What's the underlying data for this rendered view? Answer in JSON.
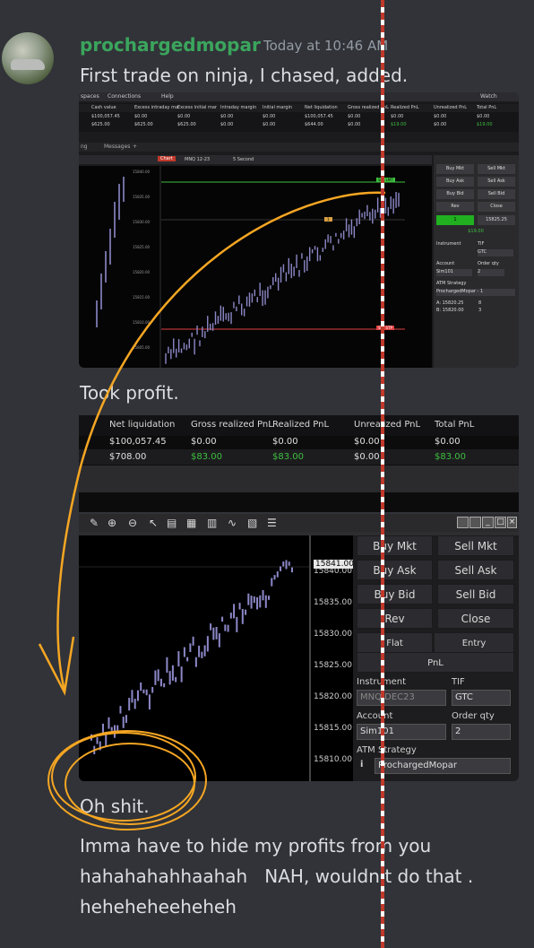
{
  "message": {
    "username": "prochargedmopar",
    "timestamp": "Today at 10:46 AM",
    "line1": "First trade on ninja, I chased, added.",
    "line2": "Took profit.",
    "line3": "Oh shit.",
    "line4": "Imma have to hide my profits from you\nhahahahahhaahah   NAH, wouldn't do that .\nheheheheeheheh"
  },
  "colors": {
    "username": "#3ba55d",
    "background": "#313338",
    "annotation": "#f5a623",
    "profit_green": "#3fbf3f",
    "candle": "#8c88c8"
  },
  "shot1": {
    "menu": [
      "spaces",
      "Connections",
      "Help"
    ],
    "window_controls": "Watch",
    "columns": [
      "Cash value",
      "Excess intraday ma",
      "Excess initial mar",
      "Intraday margin",
      "Initial margin",
      "Net liquidation",
      "Gross realized PnL",
      "Realized PnL",
      "Unrealized PnL",
      "Total PnL"
    ],
    "rows": [
      [
        "$100,057.45",
        "$0.00",
        "$0.00",
        "$0.00",
        "$0.00",
        "$100,057.45",
        "$0.00",
        "$0.00",
        "$0.00",
        "$0.00"
      ],
      [
        "$625.00",
        "$625.00",
        "$625.00",
        "$0.00",
        "$0.00",
        "$644.00",
        "$0.00",
        "$19.00",
        "$0.00",
        "$19.00"
      ]
    ],
    "tabs": [
      "ng",
      "Messages",
      "+"
    ],
    "chart_label": "Chart",
    "instrument": "MNQ 12-23",
    "interval": "5 Second",
    "sell_lmt_label": "Sell LMT",
    "sell_stp_label": "Sell STP",
    "qty_label": "1",
    "buttons": [
      "Buy Mkt",
      "Sell Mkt",
      "Buy Ask",
      "Sell Ask",
      "Buy Bid",
      "Sell Bid",
      "Rev",
      "Close"
    ],
    "position": "1",
    "position_price": "15825.25",
    "pnl": "$19.00",
    "labels": {
      "instrument": "Instrument",
      "tif": "TIF",
      "account": "Account",
      "order_qty": "Order qty",
      "atm": "ATM Strategy"
    },
    "tif_value": "GTC",
    "account_value": "Sim101",
    "qty_value": "2",
    "atm_value": "ProchargedMopar - 1",
    "quotes": [
      "A: 15820.25",
      "B: 15820.00"
    ],
    "quote_sizes": [
      "8",
      "3"
    ],
    "axis": [
      "15840.00",
      "15835.00",
      "15830.00",
      "15825.00",
      "15820.00",
      "15815.00",
      "15810.00",
      "15805.00"
    ]
  },
  "shot2": {
    "headers": [
      "Net liquidation",
      "Gross realized PnL",
      "Realized PnL",
      "Unrealized PnL",
      "Total PnL"
    ],
    "rows": [
      [
        "$100,057.45",
        "$0.00",
        "$0.00",
        "$0.00",
        "$0.00"
      ],
      [
        "$708.00",
        "$83.00",
        "$83.00",
        "$0.00",
        "$83.00"
      ]
    ]
  },
  "shot3": {
    "axis": [
      "15840.00",
      "15835.00",
      "15830.00",
      "15825.00",
      "15820.00",
      "15815.00",
      "15810.00"
    ],
    "price_flag": "15841.00",
    "buttons": [
      "Buy Mkt",
      "Sell Mkt",
      "Buy Ask",
      "Sell Ask",
      "Buy Bid",
      "Sell Bid",
      "Rev",
      "Close",
      "Flat",
      "Entry",
      "PnL"
    ],
    "labels": {
      "instrument": "Instrument",
      "tif": "TIF",
      "account": "Account",
      "order_qty": "Order qty",
      "atm": "ATM Strategy"
    },
    "instrument_value": "MNQ DEC23",
    "tif_value": "GTC",
    "account_value": "Sim101",
    "qty_value": "2",
    "atm_value": "ProchargedMopar"
  }
}
